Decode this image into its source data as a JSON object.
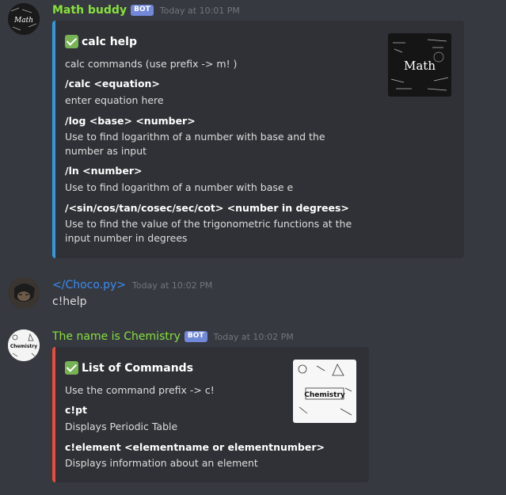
{
  "messages": [
    {
      "username": "Math buddy",
      "bot_badge": "BOT",
      "timestamp": "Today at 10:01 PM",
      "embed": {
        "title": "calc help",
        "description": "calc commands (use prefix -> m! )",
        "fields": [
          {
            "name": "/calc <equation>",
            "value": "enter equation here"
          },
          {
            "name": "/log <base> <number>",
            "value": "Use to find logarithm of a number with base and the number as input"
          },
          {
            "name": "/ln <number>",
            "value": "Use to find logarithm of a number with base e"
          },
          {
            "name": "/<sin/cos/tan/cosec/sec/cot> <number in degrees>",
            "value": "Use to find the value of the trigonometric functions at the input number in degrees"
          }
        ],
        "thumbnail_text": "Math"
      }
    },
    {
      "username": "</Choco.py>",
      "timestamp": "Today at 10:02 PM",
      "content": "c!help"
    },
    {
      "username": "The name is Chemistry",
      "bot_badge": "BOT",
      "timestamp": "Today at 10:02 PM",
      "embed": {
        "title": "List of Commands",
        "description": "Use the command prefix -> c!",
        "fields": [
          {
            "name": "c!pt",
            "value": "Displays Periodic Table"
          },
          {
            "name": "c!element <elementname or elementnumber>",
            "value": "Displays information about an element"
          }
        ],
        "thumbnail_text": "Chemistry"
      }
    }
  ],
  "colors": {
    "bot_username": "#88e03f",
    "user_username": "#3a8cf0",
    "math_embed_border": "#3498db",
    "chem_embed_border": "#e74c3c"
  }
}
